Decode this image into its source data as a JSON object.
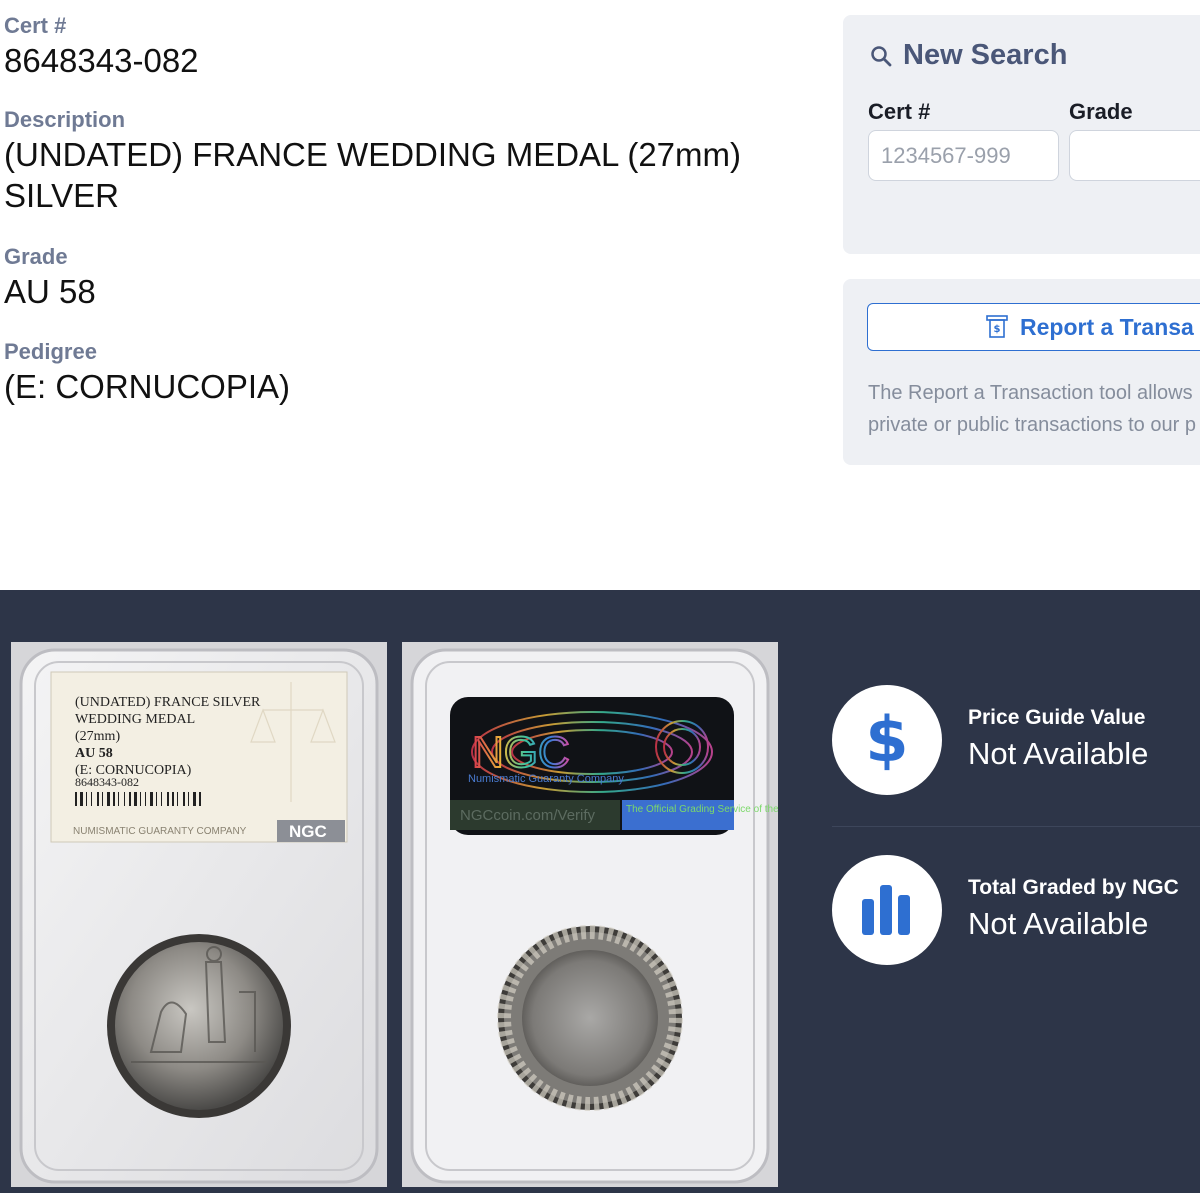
{
  "cert": {
    "label": "Cert #",
    "value": "8648343-082"
  },
  "description": {
    "label": "Description",
    "line1": "(UNDATED) FRANCE WEDDING MEDAL (27mm)",
    "line2": "SILVER"
  },
  "grade": {
    "label": "Grade",
    "value": "AU 58"
  },
  "pedigree": {
    "label": "Pedigree",
    "value": "(E: CORNUCOPIA)"
  },
  "new_search": {
    "title": "New Search",
    "icon": "search-icon",
    "cert_label": "Cert #",
    "cert_placeholder": "1234567-999",
    "grade_label": "Grade",
    "grade_value": ""
  },
  "report": {
    "button_label": "Report a Transa",
    "icon": "receipt-icon",
    "text_line1": "The Report a Transaction tool allows",
    "text_line2": "private or public transactions to our p"
  },
  "slab_label": {
    "line1": "(UNDATED) FRANCE SILVER",
    "line2": "WEDDING MEDAL",
    "line3": "(27mm)",
    "line4": "AU 58",
    "line5": "(E: CORNUCOPIA)",
    "line6": "8648343-082",
    "footer": "NUMISMATIC GUARANTY COMPANY",
    "logo": "NGC"
  },
  "slab_back": {
    "logo": "NGC",
    "tagline": "Numismatic Guaranty Company",
    "url": "NGCcoin.com/Verify",
    "badge": "The Official Grading Service of the"
  },
  "stats": [
    {
      "label": "Price Guide Value",
      "value": "Not Available",
      "icon": "dollar-icon"
    },
    {
      "label": "Total Graded by NGC",
      "value": "Not Available",
      "icon": "bar-chart-icon"
    }
  ],
  "colors": {
    "accent": "#2e6fd1",
    "label_gray": "#6f7a94",
    "panel_bg": "#eef0f4",
    "dark_bg": "#2d3548"
  }
}
